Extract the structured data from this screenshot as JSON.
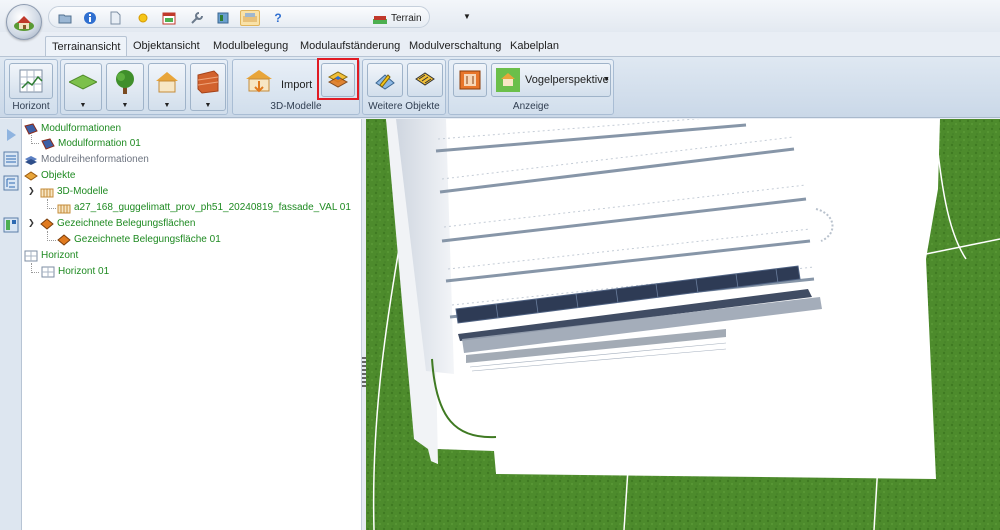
{
  "quick_access": {
    "view_dropdown": "Terrain",
    "help_glyph": "?"
  },
  "tabs": [
    {
      "label": "Terrainansicht",
      "active": true
    },
    {
      "label": "Objektansicht",
      "active": false
    },
    {
      "label": "Modulbelegung",
      "active": false
    },
    {
      "label": "Modulaufständerung",
      "active": false
    },
    {
      "label": "Modulverschaltung",
      "active": false
    },
    {
      "label": "Kabelplan",
      "active": false
    }
  ],
  "ribbon": {
    "groups": {
      "horizont": "Horizont",
      "models_3d": "3D-Modelle",
      "weitere_objekte": "Weitere Objekte",
      "anzeige": "Anzeige"
    },
    "import_label": "Import",
    "perspective_label": "Vogelperspektive"
  },
  "tree": {
    "modulformationen": "Modulformationen",
    "modulformation_01": "Modulformation 01",
    "modulreihenformationen": "Modulreihenformationen",
    "objekte": "Objekte",
    "models_3d": "3D-Modelle",
    "model_file": "a27_168_guggelimatt_prov_ph51_20240819_fassade_VAL 01",
    "gezeichnete_flaechen": "Gezeichnete Belegungsflächen",
    "gezeichnete_flaeche_01": "Gezeichnete Belegungsfläche 01",
    "horizont": "Horizont",
    "horizont_01": "Horizont 01"
  },
  "colors": {
    "tree_green": "#1e8a21",
    "highlight_red": "#e01b24",
    "grass": "#4d8b2c"
  }
}
